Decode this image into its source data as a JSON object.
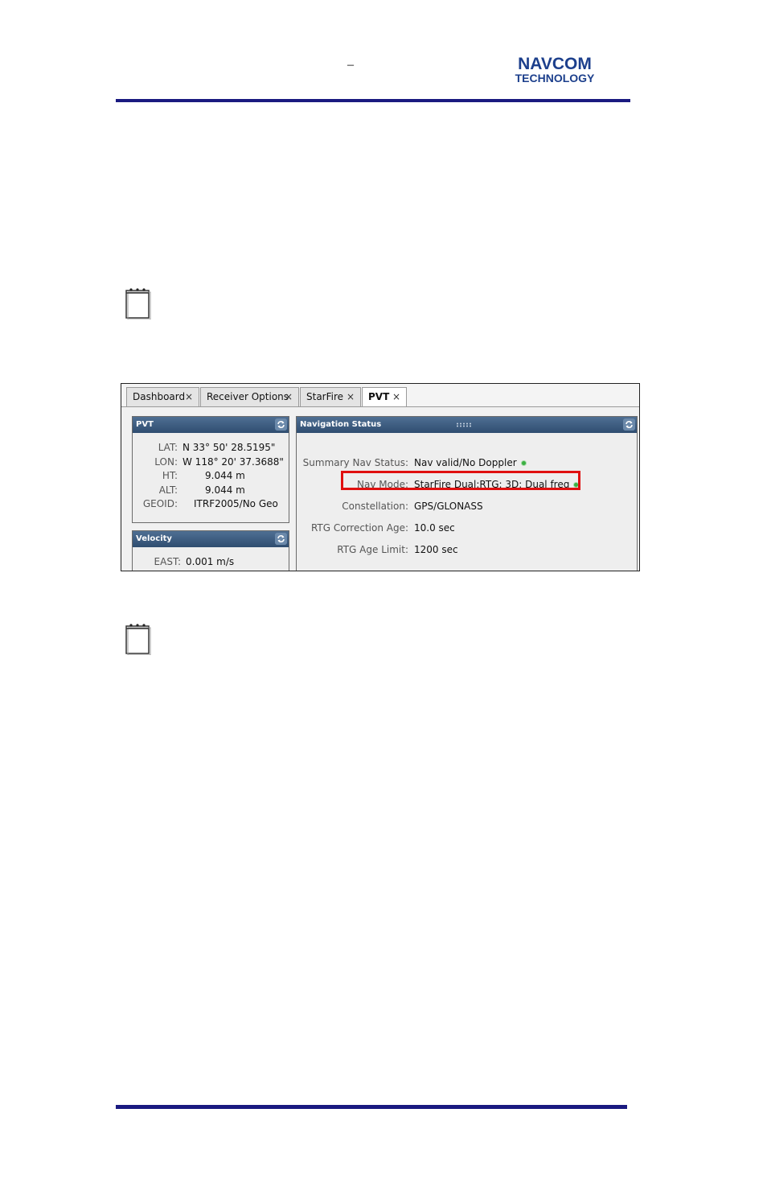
{
  "header": {
    "dash": "–",
    "logo_line1": "NAVCOM",
    "logo_line2": "TECHNOLOGY"
  },
  "icons": {
    "note": "notepad-icon",
    "refresh": "refresh-icon",
    "close": "close-icon",
    "grip": "grip-icon"
  },
  "tabs": [
    {
      "label": "Dashboard",
      "close": "×"
    },
    {
      "label": "Receiver Options",
      "close": "×"
    },
    {
      "label": "StarFire",
      "close": "×"
    },
    {
      "label": "PVT",
      "close": "×"
    }
  ],
  "pvt_panel": {
    "title": "PVT",
    "rows": [
      {
        "label": "LAT:",
        "value": "N 33° 50' 28.5195\""
      },
      {
        "label": "LON:",
        "value": "W 118° 20' 37.3688\""
      },
      {
        "label": "HT:",
        "value": "9.044 m"
      },
      {
        "label": "ALT:",
        "value": "9.044 m"
      },
      {
        "label": "GEOID:",
        "value": "ITRF2005/No Geo"
      }
    ]
  },
  "velocity_panel": {
    "title": "Velocity",
    "rows": [
      {
        "label": "EAST:",
        "value": "0.001 m/s"
      }
    ]
  },
  "nav_panel": {
    "title": "Navigation Status",
    "rows": [
      {
        "label": "Summary Nav Status:",
        "value": "Nav valid/No Doppler"
      },
      {
        "label": "Nav Mode:",
        "value": "StarFire Dual:RTG: 3D: Dual freq"
      },
      {
        "label": "Constellation:",
        "value": "GPS/GLONASS"
      },
      {
        "label": "RTG Correction Age:",
        "value": "10.0 sec"
      },
      {
        "label": "RTG Age Limit:",
        "value": "1200 sec"
      }
    ],
    "status_color": "#3cb043",
    "highlight_color": "#e01010"
  }
}
